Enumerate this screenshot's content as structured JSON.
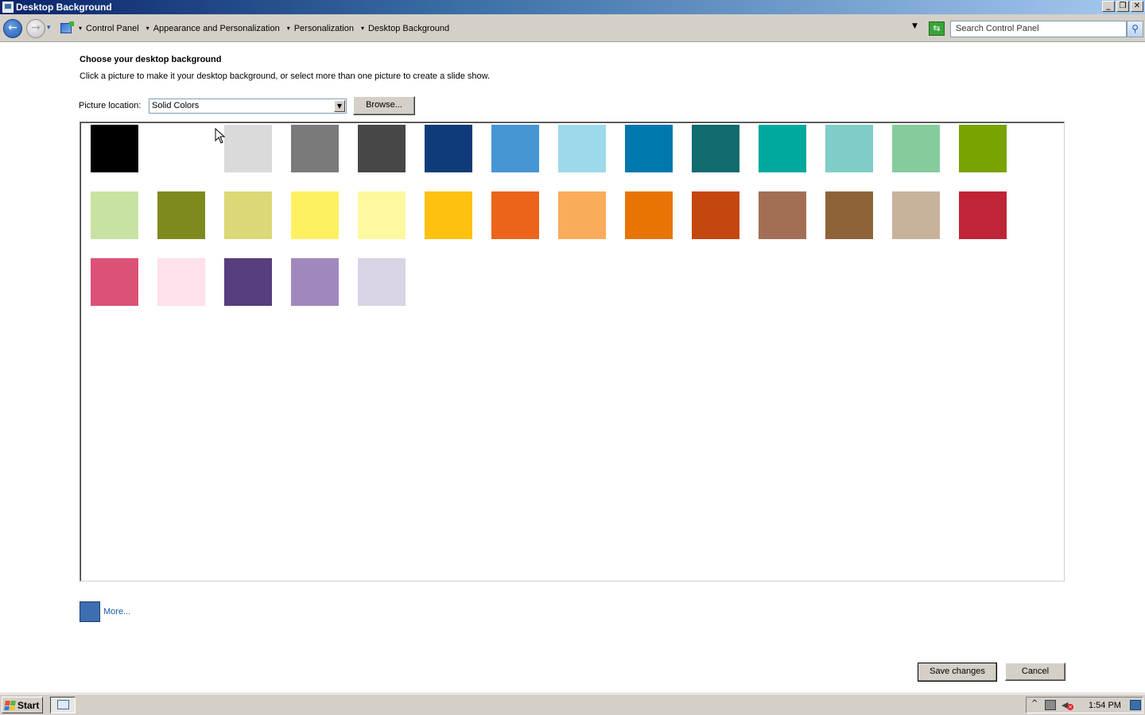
{
  "window": {
    "title": "Desktop Background",
    "minimize": "_",
    "maximize": "❐",
    "close": "✕"
  },
  "nav": {
    "back_glyph": "←",
    "forward_glyph": "→",
    "recent_glyph": "▾",
    "breadcrumb": [
      "Control Panel",
      "Appearance and Personalization",
      "Personalization",
      "Desktop Background"
    ],
    "refresh_glyph": "⇆",
    "search_placeholder": "Search Control Panel",
    "search_glyph": "⚲"
  },
  "content": {
    "heading": "Choose your desktop background",
    "instructions": "Click a picture to make it your desktop background, or select more than one picture to create a slide show.",
    "location_label": "Picture location:",
    "location_value": "Solid Colors",
    "browse_label": "Browse...",
    "swatches": [
      "#000000",
      "#ffffff",
      "#dadada",
      "#7a7a7a",
      "#474747",
      "#0f3b78",
      "#4696d4",
      "#9dd9ea",
      "#0078ad",
      "#0f6b6e",
      "#00a99d",
      "#7fcdc8",
      "#85cc9c",
      "#78a300",
      "#c8e2a1",
      "#7f8a1e",
      "#dbd876",
      "#fdf162",
      "#fef89f",
      "#fec10f",
      "#ec631a",
      "#fbab5c",
      "#e87406",
      "#c64610",
      "#a26f54",
      "#8e6338",
      "#c8b29b",
      "#bf2536",
      "#db5276",
      "#fee1ea",
      "#563e7f",
      "#a088bd",
      "#dad2e5"
    ],
    "more_color": "#3d6fb0",
    "more_label": "More..."
  },
  "footer": {
    "save_label": "Save changes",
    "cancel_label": "Cancel"
  },
  "taskbar": {
    "start_label": "Start",
    "tray_chevron": "^",
    "clock": "1:54 PM"
  }
}
